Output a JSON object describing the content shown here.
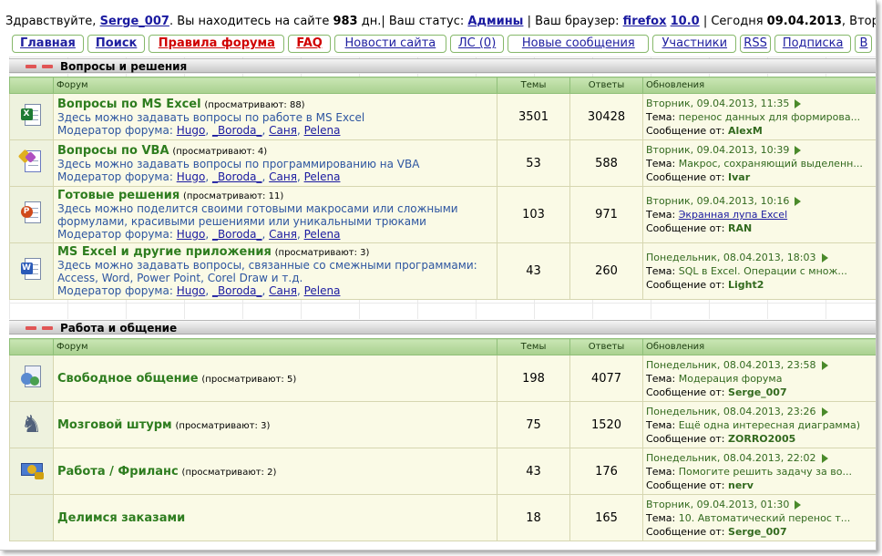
{
  "greeting": {
    "hello": "Здравствуйте,",
    "username": "Serge_007",
    "on_site_pre": ". Вы находитесь на сайте",
    "days": "983",
    "days_suffix": "дн.| Ваш статус:",
    "status": "Админы",
    "browser_pre": "| Ваш браузер:",
    "browser": "firefox",
    "browser_version": "10.0",
    "today_pre": "| Сегодня",
    "today": "09.04.2013",
    "weekday_tail": ", Вторн"
  },
  "nav": [
    "Главная",
    "Поиск",
    "Правила форума",
    "FAQ",
    "Новости сайта",
    "ЛС (0)",
    "Новые сообщения",
    "Участники",
    "RSS",
    "Подписка",
    "В"
  ],
  "columns": {
    "forum": "Форум",
    "topics": "Темы",
    "answers": "Ответы",
    "updates": "Обновления"
  },
  "labels": {
    "moderator": "Модератор форума:",
    "topic": "Тема:",
    "message_from": "Сообщение от:"
  },
  "colors": {
    "header_green": "#a9d08f",
    "forum_title": "#2e7d1f",
    "link_blue": "#1a1aa0",
    "desc_blue": "#2d55a0",
    "row_bg": "#fafae6"
  },
  "sections": [
    {
      "title": "Вопросы и решения",
      "forums": [
        {
          "icon": "excel-icon",
          "name": "Вопросы по MS Excel",
          "viewers": "(просматривают: 88)",
          "desc": "Здесь можно задавать вопросы по работе в MS Excel",
          "mods": [
            "Hugo",
            "_Boroda_",
            "Саня",
            "Pelena"
          ],
          "topics": "3501",
          "answers": "30428",
          "date": "Вторник, 09.04.2013, 11:35",
          "topic": "перенос данных для формирова...",
          "user": "AlexM",
          "topic_link": false
        },
        {
          "icon": "vba-icon",
          "name": "Вопросы по VBA",
          "viewers": "(просматривают: 4)",
          "desc": "Здесь можно задавать вопросы по программированию на VBA",
          "mods": [
            "Hugo",
            "_Boroda_",
            "Саня",
            "Pelena"
          ],
          "topics": "53",
          "answers": "588",
          "date": "Вторник, 09.04.2013, 10:39",
          "topic": "Макрос, сохраняющий выделенн...",
          "user": "Ivar",
          "topic_link": false
        },
        {
          "icon": "solutions-icon",
          "name": "Готовые решения",
          "viewers": "(просматривают: 11)",
          "desc": "Здесь можно поделится своими готовыми макросами или сложными формулами, красивыми решениями или уникальными трюками",
          "mods": [
            "Hugo",
            "_Boroda_",
            "Саня",
            "Pelena"
          ],
          "topics": "103",
          "answers": "971",
          "date": "Вторник, 09.04.2013, 10:16",
          "topic": "Экранная лупа Excel",
          "user": "RAN",
          "topic_link": true
        },
        {
          "icon": "word-icon",
          "name": "MS Excel и другие приложения",
          "viewers": "(просматривают: 3)",
          "desc": "Здесь можно задавать вопросы, связанные со смежными программами: Access, Word, Power Point, Corel Draw и т.д.",
          "mods": [
            "Hugo",
            "_Boroda_",
            "Саня",
            "Pelena"
          ],
          "topics": "43",
          "answers": "260",
          "date": "Понедельник, 08.04.2013, 18:03",
          "topic": "SQL в Excel. Операции с множ...",
          "user": "Light2",
          "topic_link": false
        }
      ]
    },
    {
      "title": "Работа и общение",
      "forums": [
        {
          "icon": "chat-icon",
          "name": "Свободное общение",
          "viewers": "(просматривают: 5)",
          "topics": "198",
          "answers": "4077",
          "date": "Понедельник, 08.04.2013, 23:58",
          "topic": "Модерация форума",
          "user": "Serge_007",
          "topic_link": false
        },
        {
          "icon": "chess-knight-icon",
          "name": "Мозговой штурм",
          "viewers": "(просматривают: 3)",
          "topics": "75",
          "answers": "1520",
          "date": "Понедельник, 08.04.2013, 23:26",
          "topic": "Ещё одна интересная диаграмма)",
          "user": "ZORRO2005",
          "topic_link": false
        },
        {
          "icon": "money-icon",
          "name": "Работа / Фриланс",
          "viewers": "(просматривают: 2)",
          "topics": "43",
          "answers": "176",
          "date": "Понедельник, 08.04.2013, 22:02",
          "topic": "Помогите решить задачу за во...",
          "user": "nerv",
          "topic_link": false
        },
        {
          "icon": "orders-icon",
          "name": "Делимся заказами",
          "viewers": "",
          "topics": "18",
          "answers": "165",
          "date": "Вторник, 09.04.2013, 01:30",
          "topic": "10. Автоматический перенос т...",
          "user": "Serge_007",
          "topic_link": false
        }
      ]
    }
  ]
}
